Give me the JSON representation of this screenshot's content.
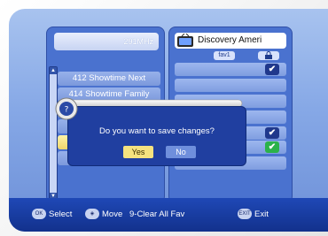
{
  "top_left": {
    "frequency": "291MHz"
  },
  "channel_list": [
    {
      "label": "412 Showtime Next",
      "style": "dim"
    },
    {
      "label": "414 Showtime Family",
      "style": "dim"
    },
    {
      "label": "",
      "style": "dim"
    },
    {
      "label": "",
      "style": "dim"
    },
    {
      "label": "",
      "style": "hl"
    },
    {
      "label": "",
      "style": "dim"
    }
  ],
  "right_panel": {
    "title": "Discovery Ameri",
    "icon_name": "tv-icon",
    "col_fav": "fav1",
    "col_lock": "lock-icon",
    "rows_checked": [
      true,
      false,
      false,
      false,
      true,
      false
    ],
    "highlight_row": 4
  },
  "dialog": {
    "message": "Do you want to save changes?",
    "yes": "Yes",
    "no": "No"
  },
  "hints": {
    "ok_icon": "OK",
    "select": "Select",
    "move_icon": "move-icon",
    "move": "Move",
    "clear": "9-Clear All Fav",
    "exit_icon": "EXIT",
    "exit": "Exit"
  },
  "colors": {
    "accent": "#203fa0",
    "highlight": "#f5e27f",
    "check_green": "#2bb24a",
    "check_blue": "#20388c"
  }
}
